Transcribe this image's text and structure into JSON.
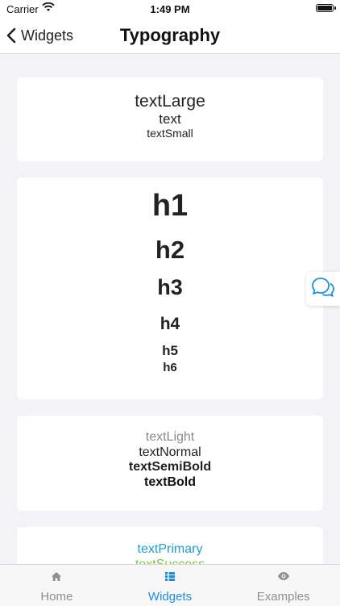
{
  "status_bar": {
    "carrier": "Carrier",
    "time": "1:49 PM"
  },
  "nav": {
    "back_label": "Widgets",
    "title": "Typography"
  },
  "sizes_card": {
    "large": "textLarge",
    "normal": "text",
    "small": "textSmall"
  },
  "headings_card": {
    "h1": "h1",
    "h2": "h2",
    "h3": "h3",
    "h4": "h4",
    "h5": "h5",
    "h6": "h6"
  },
  "weights_card": {
    "light": "textLight",
    "normal": "textNormal",
    "semibold": "textSemiBold",
    "bold": "textBold"
  },
  "colors_card": {
    "primary": "textPrimary",
    "success": "textSuccess",
    "primary_color": "#1a9fd6",
    "success_color": "#7ac943"
  },
  "tab_bar": {
    "active_color": "#1a8fe3",
    "tabs": [
      {
        "label": "Home",
        "icon": "home-icon"
      },
      {
        "label": "Widgets",
        "icon": "list-icon"
      },
      {
        "label": "Examples",
        "icon": "eye-icon"
      }
    ]
  }
}
